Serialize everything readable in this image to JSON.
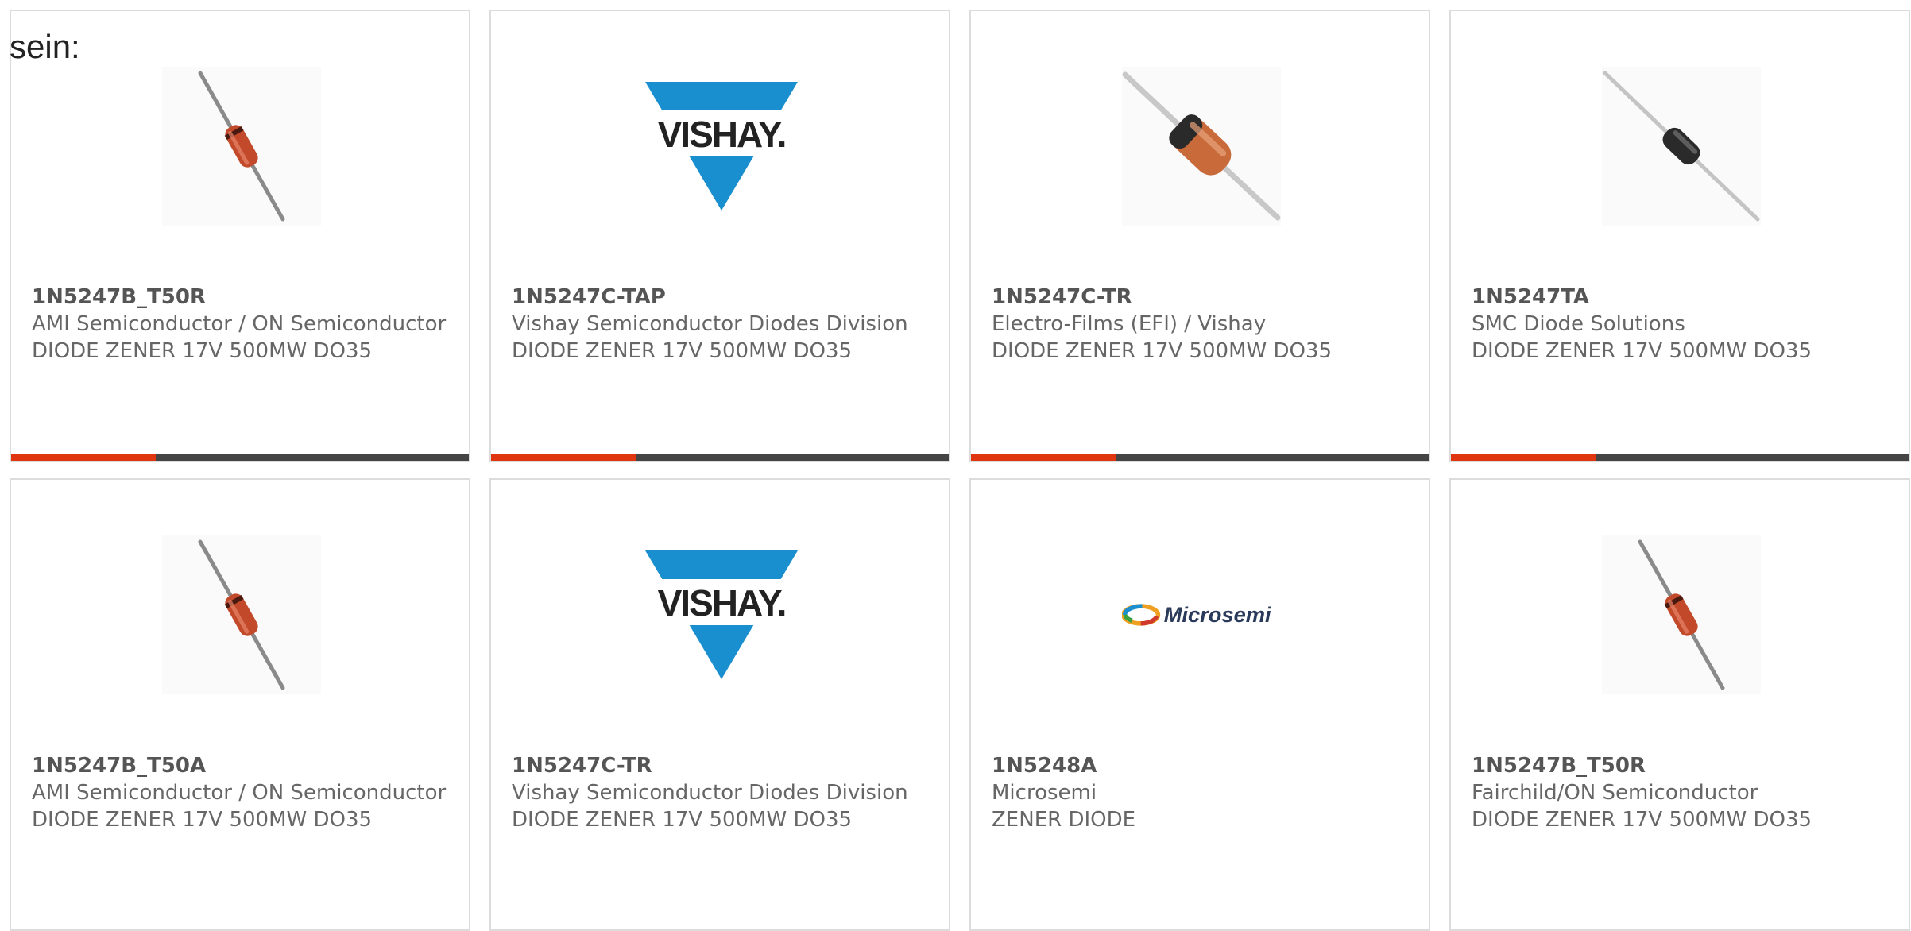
{
  "intro_text": "sein:",
  "colors": {
    "accent": "#e0360f",
    "bar": "#444444",
    "vishay_blue": "#1a8fd0",
    "diode_glass": "#c24a2a"
  },
  "products": [
    {
      "part": "1N5247B_T50R",
      "manufacturer": "AMI Semiconductor / ON Semiconductor",
      "description": "DIODE ZENER 17V 500MW DO35",
      "image": "diode-glass-thin-icon"
    },
    {
      "part": "1N5247C-TAP",
      "manufacturer": "Vishay Semiconductor Diodes Division",
      "description": "DIODE ZENER 17V 500MW DO35",
      "image": "vishay-logo",
      "logo_text": "VISHAY."
    },
    {
      "part": "1N5247C-TR",
      "manufacturer": "Electro-Films (EFI) / Vishay",
      "description": "DIODE ZENER 17V 500MW DO35",
      "image": "diode-glass-thick-icon"
    },
    {
      "part": "1N5247TA",
      "manufacturer": "SMC Diode Solutions",
      "description": "DIODE ZENER 17V 500MW DO35",
      "image": "diode-black-icon"
    },
    {
      "part": "1N5247B_T50A",
      "manufacturer": "AMI Semiconductor / ON Semiconductor",
      "description": "DIODE ZENER 17V 500MW DO35",
      "image": "diode-glass-thin-icon"
    },
    {
      "part": "1N5247C-TR",
      "manufacturer": "Vishay Semiconductor Diodes Division",
      "description": "DIODE ZENER 17V 500MW DO35",
      "image": "vishay-logo",
      "logo_text": "VISHAY."
    },
    {
      "part": "1N5248A",
      "manufacturer": "Microsemi",
      "description": "ZENER DIODE",
      "image": "microsemi-logo",
      "logo_text": "Microsemi"
    },
    {
      "part": "1N5247B_T50R",
      "manufacturer": "Fairchild/ON Semiconductor",
      "description": "DIODE ZENER 17V 500MW DO35",
      "image": "diode-glass-thin-icon"
    }
  ]
}
